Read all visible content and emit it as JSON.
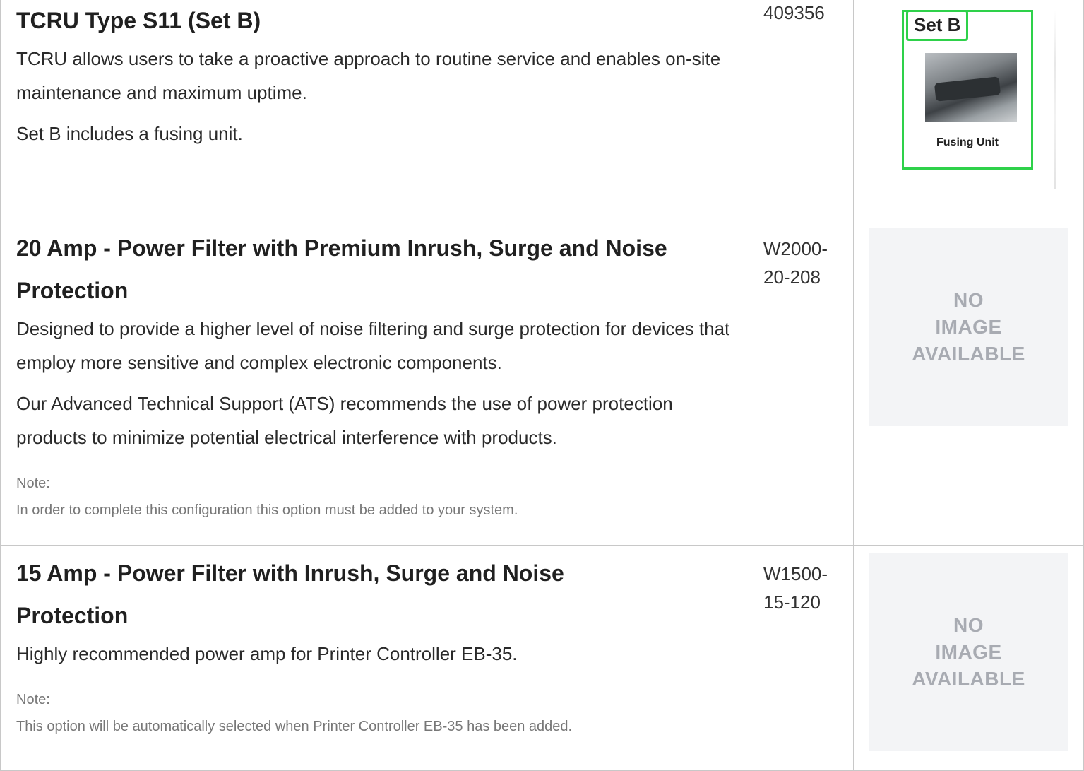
{
  "rows": [
    {
      "title": "TCRU Type S11 (Set B)",
      "paragraphs": [
        "TCRU allows users to take a proactive approach to routine service and enables on-site maintenance and maximum uptime.",
        "Set B includes a fusing unit."
      ],
      "part_number": "409356",
      "image": {
        "tag": "Set B",
        "caption": "Fusing Unit",
        "border_color": "#2ed14a"
      }
    },
    {
      "title": "20 Amp - Power Filter with Premium Inrush, Surge and Noise Protection",
      "paragraphs": [
        "Designed to provide a higher level of noise filtering and surge protection for devices that employ more sensitive and complex electronic components.",
        "Our Advanced Technical Support (ATS) recommends the use of power protection products to minimize potential electrical interference with products."
      ],
      "note_label": "Note:",
      "note_text": "In order to complete this configuration this option must be added to your system.",
      "part_number": "W2000-20-208",
      "no_image": [
        "NO",
        "IMAGE",
        "AVAILABLE"
      ]
    },
    {
      "title": "15 Amp - Power Filter with Inrush, Surge and Noise Protection",
      "paragraphs": [
        "Highly recommended power amp for Printer Controller EB-35."
      ],
      "note_label": "Note:",
      "note_text": "This option will be automatically selected when Printer Controller EB-35 has been added.",
      "part_number": "W1500-15-120",
      "no_image": [
        "NO",
        "IMAGE",
        "AVAILABLE"
      ]
    }
  ],
  "colors": {
    "border": "#c8c8c8",
    "placeholder_bg": "#f3f4f6",
    "placeholder_text": "#a8abb2",
    "note_text": "#777777"
  }
}
